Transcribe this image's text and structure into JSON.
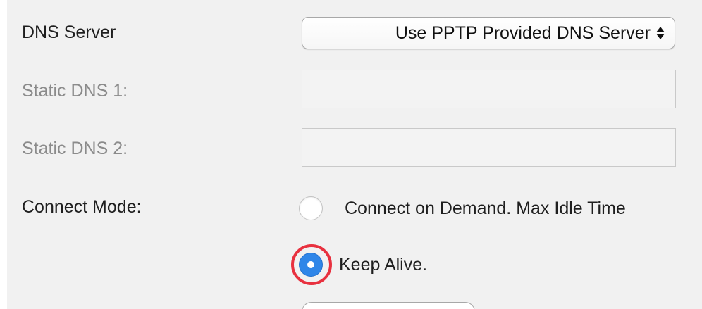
{
  "dns_server": {
    "label": "DNS Server",
    "selected": "Use PPTP Provided DNS Server",
    "arrows_icon": "up-down-chevron-icon"
  },
  "static_dns_1": {
    "label": "Static DNS 1:",
    "value": "",
    "disabled": true
  },
  "static_dns_2": {
    "label": "Static DNS 2:",
    "value": "",
    "disabled": true
  },
  "connect_mode": {
    "label": "Connect Mode:",
    "options": [
      {
        "label": "Connect on Demand. Max Idle Time",
        "selected": false
      },
      {
        "label": "Keep Alive.",
        "selected": true
      }
    ]
  },
  "colors": {
    "highlight": "#e8313f",
    "radio_selected": "#2f86e8",
    "disabled_text": "#8b8b8b"
  }
}
